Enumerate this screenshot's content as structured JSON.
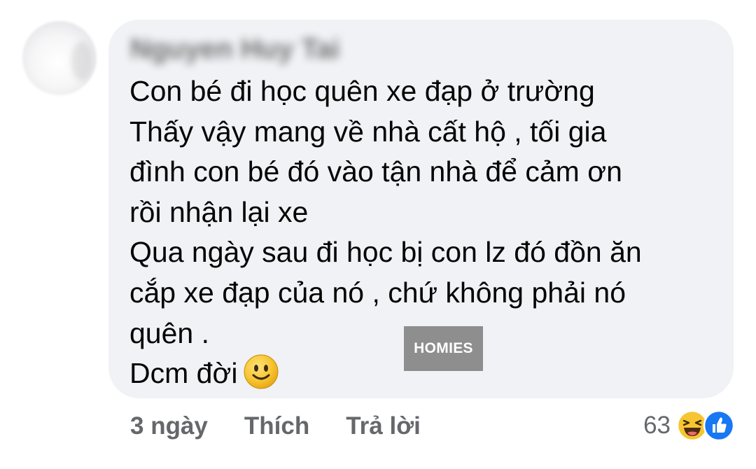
{
  "comment": {
    "author": "Nguyen Huy Tai",
    "lines": [
      "Con bé đi học quên xe đạp ở trường",
      "Thấy vậy mang về nhà cất hộ , tối gia",
      "đình con bé đó vào tận nhà để cảm ơn",
      "rồi nhận lại xe",
      "Qua ngày sau đi học bị con lz đó đồn ăn",
      "cắp xe đạp của nó , chứ không phải nó",
      "quên .",
      "Dcm đời"
    ],
    "trailing_emoji": "slightly-smiling-face-icon"
  },
  "watermark": "HOMIES",
  "actions": {
    "time": "3 ngày",
    "like": "Thích",
    "reply": "Trả lời"
  },
  "reactions": {
    "count": "63",
    "icons": [
      "haha-reaction-icon",
      "like-reaction-icon"
    ]
  },
  "colors": {
    "bubble": "#f0f2f5",
    "text": "#050505",
    "secondary": "#65676b",
    "like_blue": "#1877f2",
    "emoji_yellow": "#f7c531"
  }
}
